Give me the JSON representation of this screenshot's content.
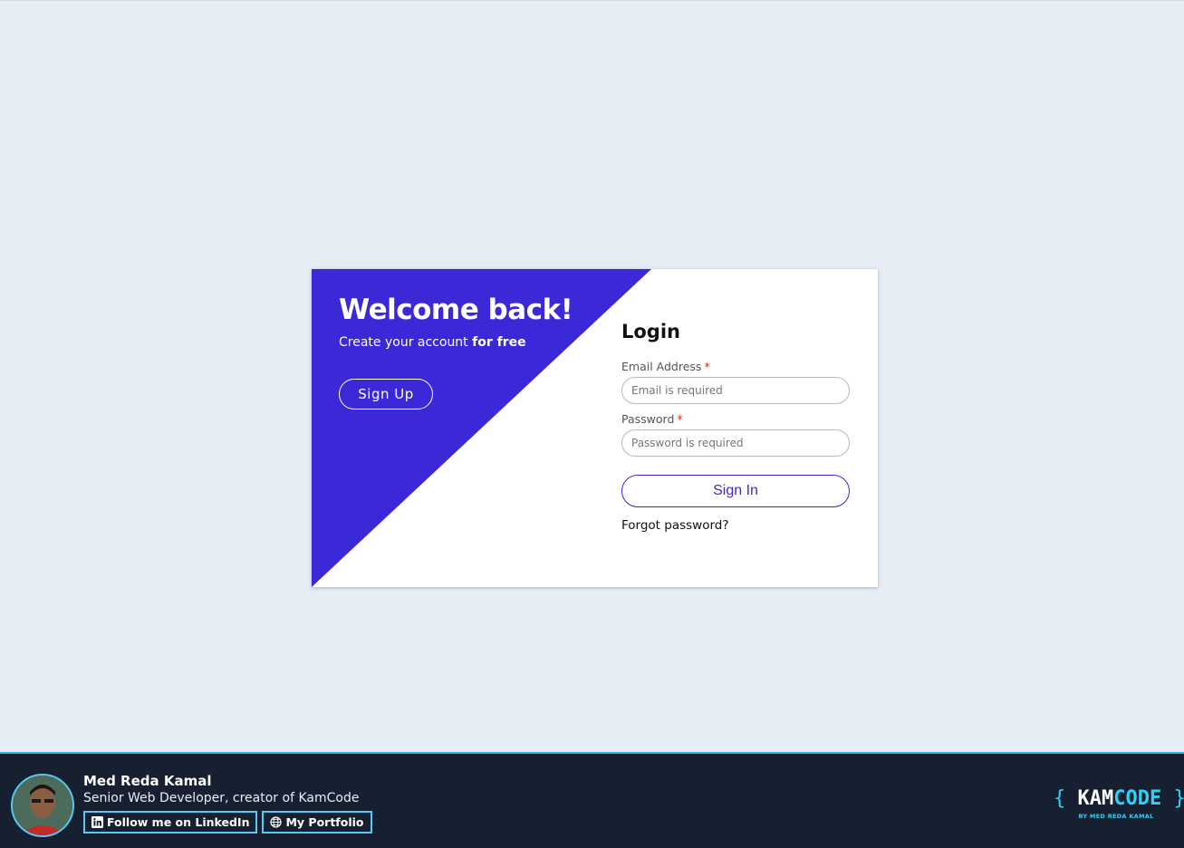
{
  "colors": {
    "page_background": "#e6edf5",
    "accent": "#3b28d6",
    "footer_background": "#162031",
    "footer_accent": "#2fd0f5",
    "required_marker": "#e02424"
  },
  "welcome": {
    "title": "Welcome back!",
    "subtitle_prefix": "Create your account ",
    "subtitle_emphasis": "for free",
    "signup_label": "Sign Up"
  },
  "login": {
    "title": "Login",
    "email_label": "Email Address",
    "email_placeholder": "Email is required",
    "password_label": "Password",
    "password_placeholder": "Password is required",
    "required_marker": "*",
    "signin_label": "Sign In",
    "forgot_label": "Forgot password?"
  },
  "footer": {
    "author_name": "Med Reda Kamal",
    "author_role": "Senior Web Developer, creator of KamCode",
    "linkedin_label": "Follow me on LinkedIn",
    "portfolio_label": "My Portfolio",
    "linkedin_icon": "linkedin-icon",
    "portfolio_icon": "globe-icon",
    "brand": {
      "open_brace": "{",
      "kam": "KAM",
      "code": "CODE",
      "close_brace": "}",
      "byline": "BY MED REDA KAMAL"
    }
  }
}
